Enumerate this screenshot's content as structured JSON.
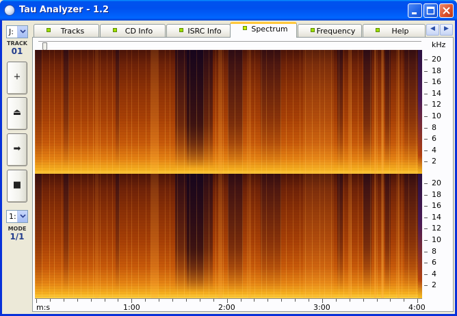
{
  "window": {
    "title": "Tau Analyzer - 1.2"
  },
  "titlebar_buttons": {
    "minimize_icon": "minimize-icon",
    "maximize_icon": "maximize-icon",
    "close_icon": "close-icon"
  },
  "sidebar": {
    "drive_select": "J:",
    "track_label": "TRACK",
    "track_number": "01",
    "buttons": [
      {
        "name": "add-button",
        "glyph": "+"
      },
      {
        "name": "eject-button",
        "glyph": "⏏"
      },
      {
        "name": "play-button",
        "glyph": "➡"
      },
      {
        "name": "stop-button",
        "glyph": "■"
      }
    ],
    "mode_select": "1:",
    "mode_label": "MODE",
    "mode_value": "1/1"
  },
  "tabs": [
    {
      "label": "Tracks",
      "active": false
    },
    {
      "label": "CD Info",
      "active": false
    },
    {
      "label": "ISRC Info",
      "active": false
    },
    {
      "label": "Spectrum",
      "active": true
    },
    {
      "label": "Frequency",
      "active": false
    },
    {
      "label": "Help",
      "active": false
    }
  ],
  "tab_scroll": {
    "left": "◀",
    "right": "▶"
  },
  "spectrum": {
    "unit": "kHz",
    "y_ticks": [
      "20",
      "18",
      "16",
      "14",
      "12",
      "10",
      "8",
      "6",
      "4",
      "2"
    ],
    "x_axis_label": "m:s",
    "x_ticks": [
      "1:00",
      "2:00",
      "3:00",
      "4:00"
    ],
    "colors": {
      "low": "#4a1408",
      "mid": "#c85a0a",
      "high": "#ffd040"
    }
  }
}
